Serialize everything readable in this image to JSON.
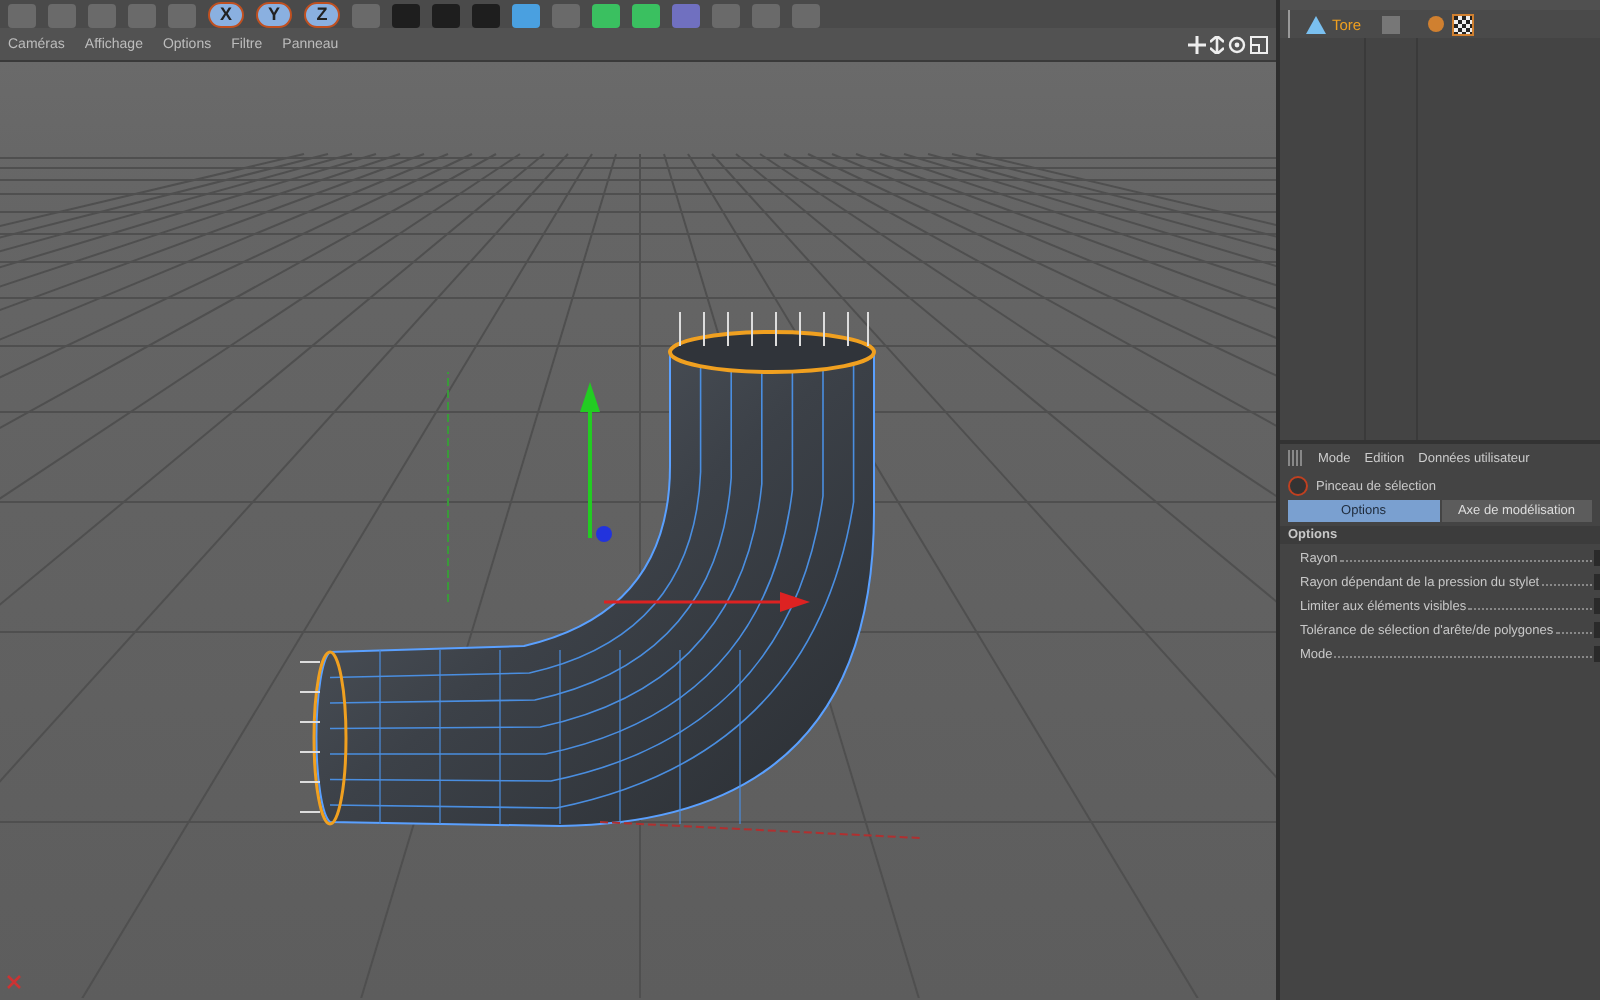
{
  "toolbar": {
    "axis_buttons": [
      {
        "label": "X",
        "selected": true
      },
      {
        "label": "Y",
        "selected": true
      },
      {
        "label": "Z",
        "selected": true
      }
    ]
  },
  "viewport": {
    "menu": [
      "Caméras",
      "Affichage",
      "Options",
      "Filtre",
      "Panneau"
    ]
  },
  "object_manager": {
    "objects": [
      {
        "name": "Tore",
        "selected": true
      }
    ]
  },
  "attributes": {
    "menu": [
      "Mode",
      "Edition",
      "Données utilisateur"
    ],
    "tool_name": "Pinceau de sélection",
    "tabs": [
      {
        "label": "Options",
        "selected": true
      },
      {
        "label": "Axe de modélisation",
        "selected": false
      }
    ],
    "section": "Options",
    "fields": [
      {
        "label": "Rayon"
      },
      {
        "label": "Rayon dépendant de la pression du stylet"
      },
      {
        "label": "Limiter aux éléments visibles"
      },
      {
        "label": "Tolérance de sélection d'arête/de polygones"
      },
      {
        "label": "Mode"
      }
    ]
  }
}
